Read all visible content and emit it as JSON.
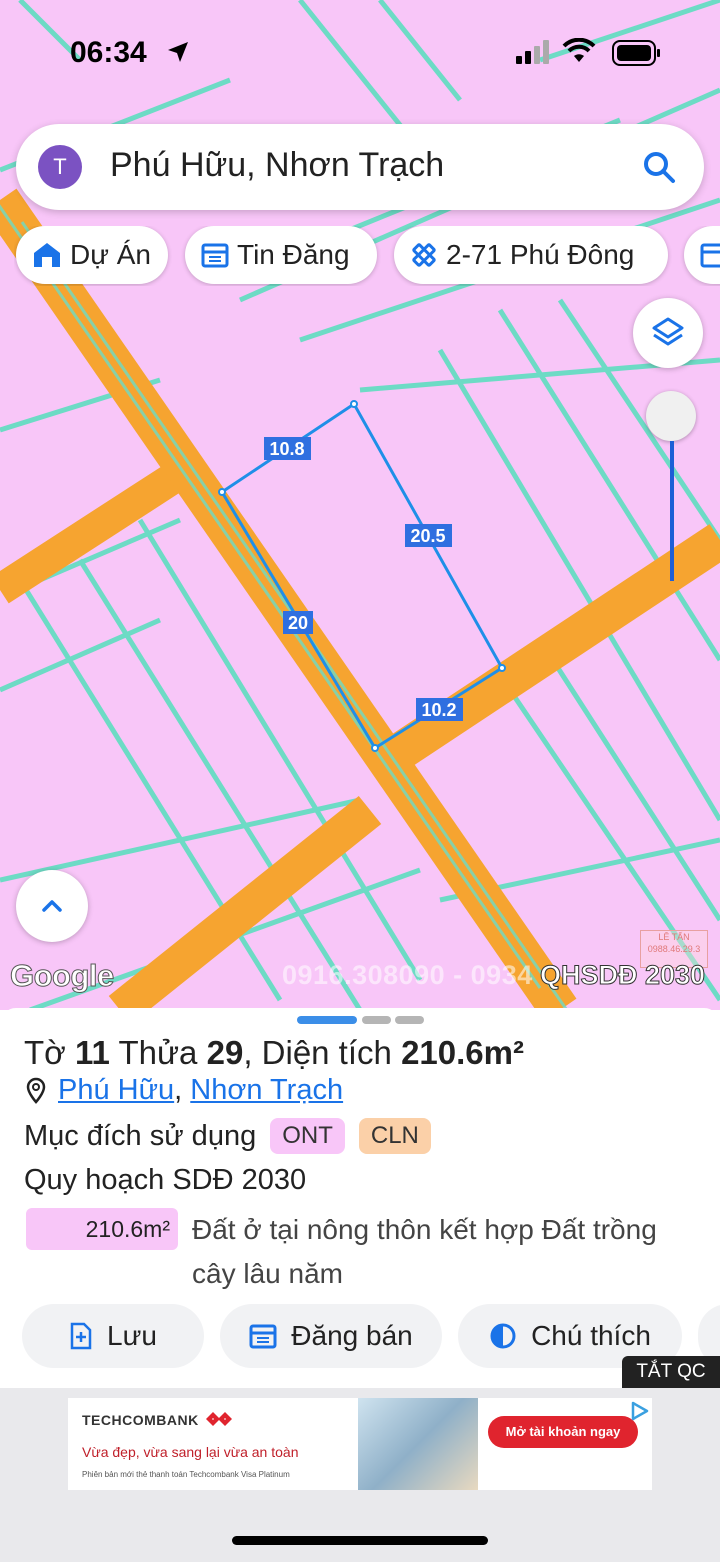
{
  "status_bar": {
    "time": "06:34"
  },
  "search": {
    "avatar_letter": "T",
    "query": "Phú Hữu, Nhơn Trạch"
  },
  "chips": [
    {
      "label": "Dự Án",
      "icon": "house-icon"
    },
    {
      "label": "Tin Đăng",
      "icon": "calendar-icon"
    },
    {
      "label": "2-71 Phú Đông",
      "icon": "ruler-icon"
    }
  ],
  "map": {
    "plot_edges": [
      "10.8",
      "20.5",
      "20",
      "10.2"
    ],
    "google_label": "Google",
    "watermark": "0916.308090 - 0934",
    "version_label": "QHSDĐ 2030",
    "stamp_text": [
      "LÊ TẤN",
      "0988.46.29.3"
    ],
    "colors": {
      "land": "#f8c6f8",
      "road": "#f6a430",
      "parcel_line": "#6ddbc5",
      "measure_line": "#1f8fe8"
    }
  },
  "sheet": {
    "title_prefix": "Tờ",
    "sheet_no": "11",
    "parcel_label": "Thửa",
    "parcel_no": "29",
    "area_label": ", Diện tích",
    "area_value": "210.6m²",
    "ward": "Phú Hữu",
    "district": "Nhơn Trạch",
    "purpose_label": "Mục đích sử dụng",
    "tags": [
      "ONT",
      "CLN"
    ],
    "plan_label": "Quy hoạch SDĐ 2030",
    "area_box": "210.6m²",
    "area_desc": "Đất ở tại nông thôn kết hợp Đất trồng cây lâu năm",
    "actions": [
      "Lưu",
      "Đăng bán",
      "Chú thích"
    ]
  },
  "ad": {
    "close_label": "TẮT QC",
    "brand": "TECHCOMBANK",
    "headline": "Vừa đẹp, vừa sang lại vừa an toàn",
    "sub": "Phiên bản mới thẻ thanh toán Techcombank Visa Platinum",
    "cta": "Mở tài khoản ngay"
  }
}
